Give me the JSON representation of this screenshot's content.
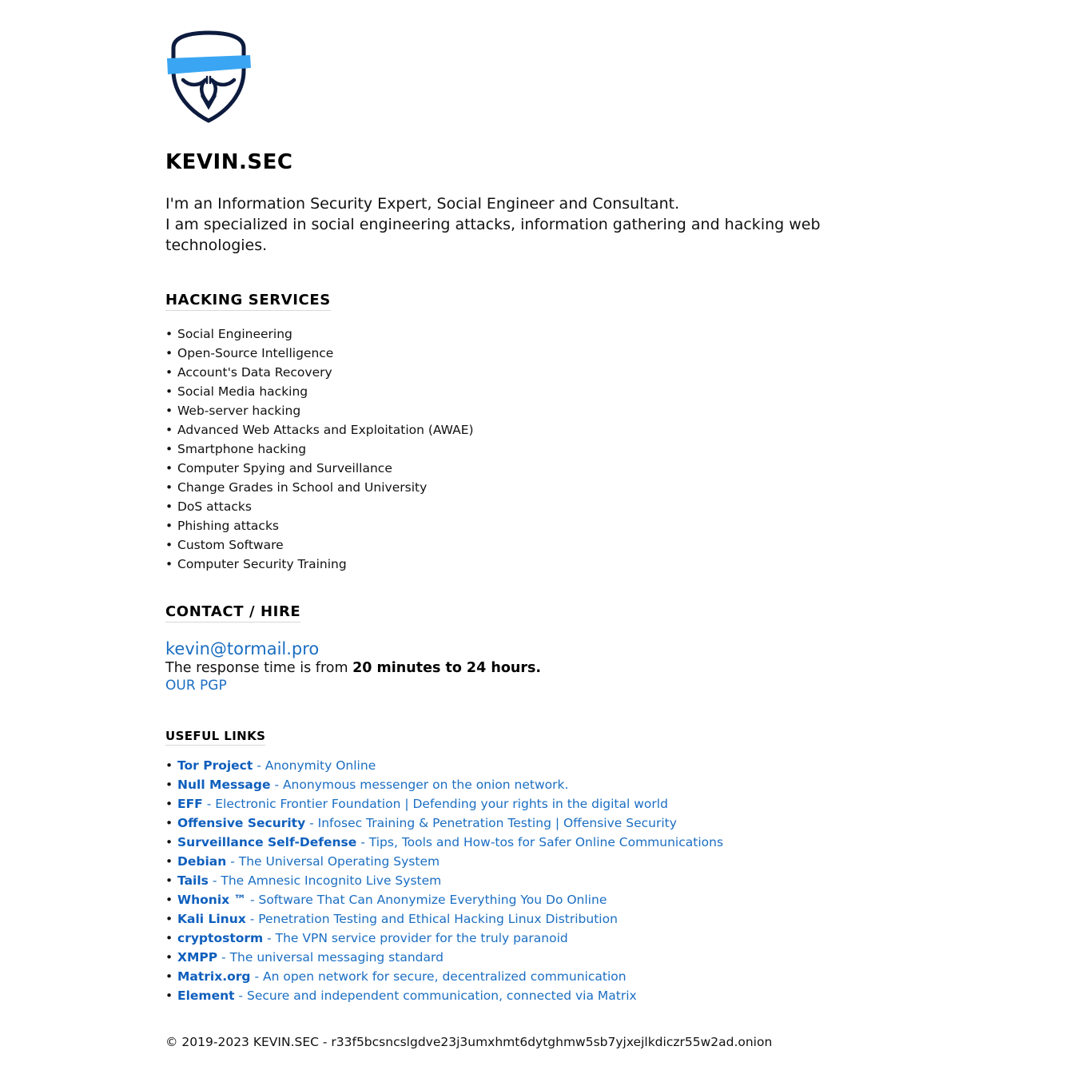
{
  "brand": {
    "logo_icon": "anonymous-mask-logo-icon",
    "accent_color": "#3aa6f3",
    "mask_color": "#0d1b3e",
    "title": "KEVIN.SEC"
  },
  "intro": {
    "line1": "I'm an Information Security Expert, Social Engineer and Consultant.",
    "line2": "I am specialized in social engineering attacks, information gathering and hacking web technologies."
  },
  "services": {
    "heading": "HACKING SERVICES",
    "items": [
      "Social Engineering",
      "Open-Source Intelligence",
      "Account's Data Recovery",
      "Social Media hacking",
      "Web-server hacking",
      "Advanced Web Attacks and Exploitation (AWAE)",
      "Smartphone hacking",
      "Computer Spying and Surveillance",
      "Change Grades in School and University",
      "DoS attacks",
      "Phishing attacks",
      "Custom Software",
      "Computer Security Training"
    ]
  },
  "contact": {
    "heading": "CONTACT / HIRE",
    "email": "kevin@tormail.pro",
    "response_prefix": "The response time is from",
    "response_time": "20 minutes to 24 hours.",
    "pgp_label": "OUR PGP",
    "link_color": "#1b6ec2"
  },
  "links": {
    "heading": "USEFUL LINKS",
    "items": [
      {
        "name": "Tor Project",
        "desc": "- Anonymity Online"
      },
      {
        "name": "Null Message",
        "desc": "- Anonymous messenger on the onion network."
      },
      {
        "name": "EFF",
        "desc": "- Electronic Frontier Foundation | Defending your rights in the digital world"
      },
      {
        "name": "Offensive Security",
        "desc": "- Infosec Training & Penetration Testing | Offensive Security"
      },
      {
        "name": "Surveillance Self-Defense",
        "desc": "- Tips, Tools and How-tos for Safer Online Communications"
      },
      {
        "name": "Debian",
        "desc": "- The Universal Operating System"
      },
      {
        "name": "Tails",
        "desc": "- The Amnesic Incognito Live System"
      },
      {
        "name": "Whonix ™",
        "desc": "- Software That Can Anonymize Everything You Do Online"
      },
      {
        "name": "Kali Linux",
        "desc": "- Penetration Testing and Ethical Hacking Linux Distribution"
      },
      {
        "name": "cryptostorm",
        "desc": "- The VPN service provider for the truly paranoid"
      },
      {
        "name": "XMPP",
        "desc": "- The universal messaging standard"
      },
      {
        "name": "Matrix.org",
        "desc": "- An open network for secure, decentralized communication"
      },
      {
        "name": "Element",
        "desc": "- Secure and independent communication, connected via Matrix"
      }
    ]
  },
  "footer": {
    "text": "© 2019-2023 KEVIN.SEC - r33f5bcsncslgdve23j3umxhmt6dytghmw5sb7yjxejlkdiczr55w2ad.onion"
  }
}
